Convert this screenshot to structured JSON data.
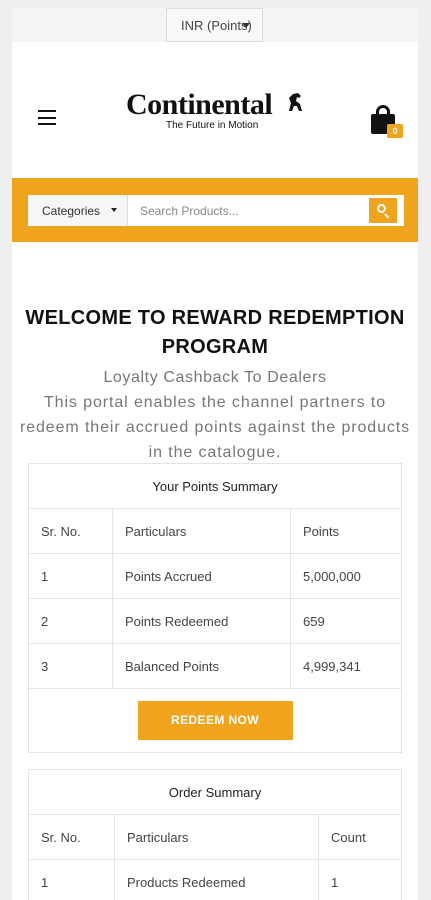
{
  "currency": {
    "selected": "INR (Points)"
  },
  "header": {
    "logo_text": "Continental",
    "logo_tagline": "The Future in Motion",
    "cart_count": "0"
  },
  "search": {
    "category_label": "Categories",
    "placeholder": "Search Products..."
  },
  "welcome": {
    "title": "WELCOME TO REWARD REDEMPTION PROGRAM",
    "subtitle": "Loyalty Cashback To Dealers",
    "description": "This portal enables the channel partners to redeem their accrued points against the products in the catalogue."
  },
  "points_summary": {
    "caption": "Your Points Summary",
    "headers": [
      "Sr. No.",
      "Particulars",
      "Points"
    ],
    "rows": [
      [
        "1",
        "Points Accrued",
        "5,000,000"
      ],
      [
        "2",
        "Points Redeemed",
        "659"
      ],
      [
        "3",
        "Balanced Points",
        "4,999,341"
      ]
    ],
    "redeem_label": "REDEEM NOW"
  },
  "order_summary": {
    "caption": "Order Summary",
    "headers": [
      "Sr. No.",
      "Particulars",
      "Count"
    ],
    "rows": [
      [
        "1",
        "Products Redeemed",
        "1"
      ]
    ]
  },
  "colors": {
    "accent": "#f0a31c"
  }
}
